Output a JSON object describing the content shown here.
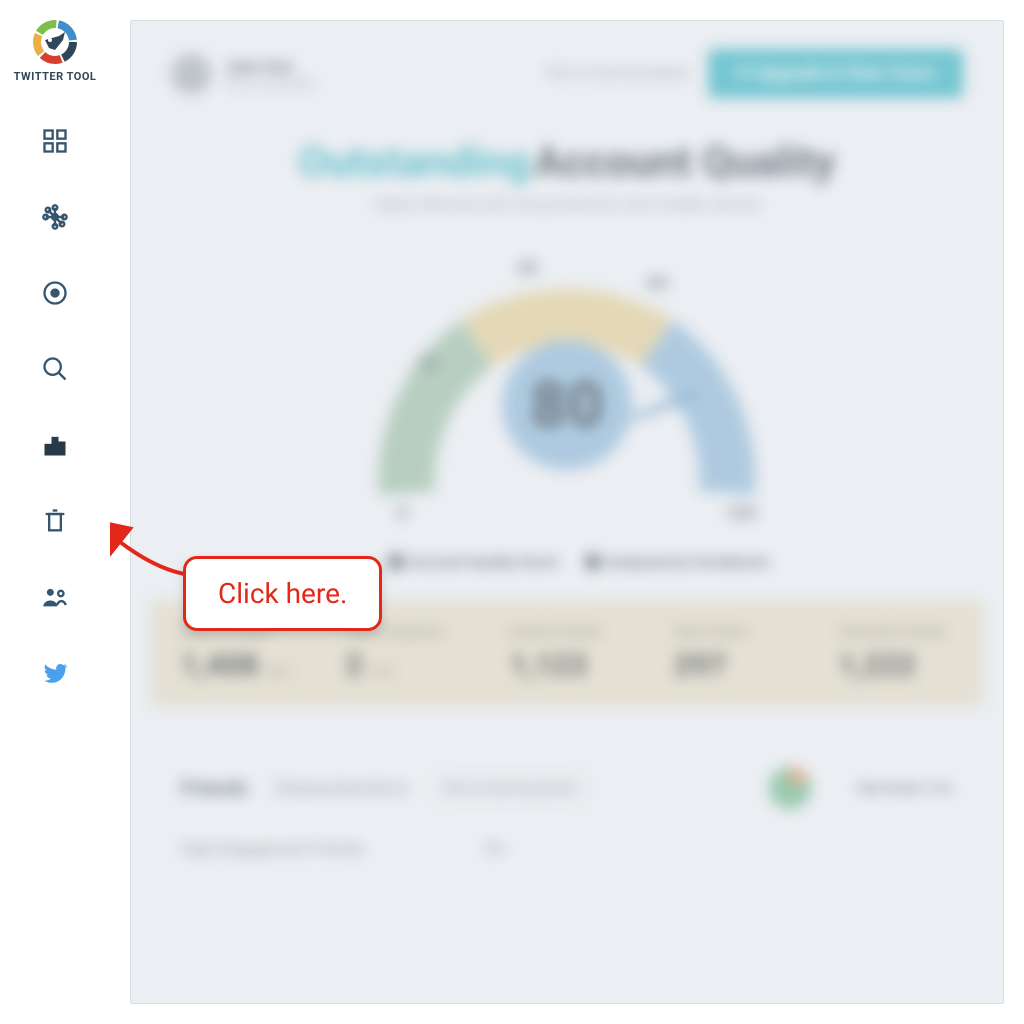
{
  "brand": {
    "label": "TWITTER TOOL"
  },
  "sidebar_icons": [
    "dashboard",
    "network",
    "target",
    "search",
    "stats",
    "trash",
    "friends",
    "twitter"
  ],
  "annotation": {
    "callout_text": "Click here.",
    "highlight_target": "trash-nav-item"
  },
  "profile": {
    "name": "John Doe",
    "handle": "This is a preview"
  },
  "header_note": "This is a dummy preview",
  "cta_label": "⟳ Upgrade & View Yours",
  "title": {
    "highlighted": "Outstanding",
    "rest": "Account Quality",
    "subtitle": "Highly influential with strong interaction and a healthy network"
  },
  "gauge": {
    "score": 80,
    "ticks": {
      "t0": "0",
      "t20": "20",
      "t40": "40",
      "t60": "60",
      "t100": "100"
    },
    "band_label": "GOOD",
    "band_outer": "OUTSTANDING"
  },
  "legend": {
    "a": "Account Quality Score",
    "b": "Analyzed by Circleboom"
  },
  "stats": [
    {
      "label": "Days on Twitter",
      "value": "1,408",
      "unit": "days"
    },
    {
      "label": "Tweet Frequency",
      "value": "2",
      "unit": "/day"
    },
    {
      "label": "Inactive Friends",
      "value": "1,123",
      "unit": ""
    },
    {
      "label": "Fake Friends",
      "value": "297",
      "unit": ""
    },
    {
      "label": "Overactive Friends",
      "value": "1,222",
      "unit": ""
    }
  ],
  "friends_section": {
    "title": "Friends",
    "subtitle": "Characteristics",
    "note": "This is a\ndummy\npreview",
    "caption": "Fake Friends 11.8%"
  },
  "engagement": {
    "label": "High Engagement Friends",
    "value": "5%"
  }
}
